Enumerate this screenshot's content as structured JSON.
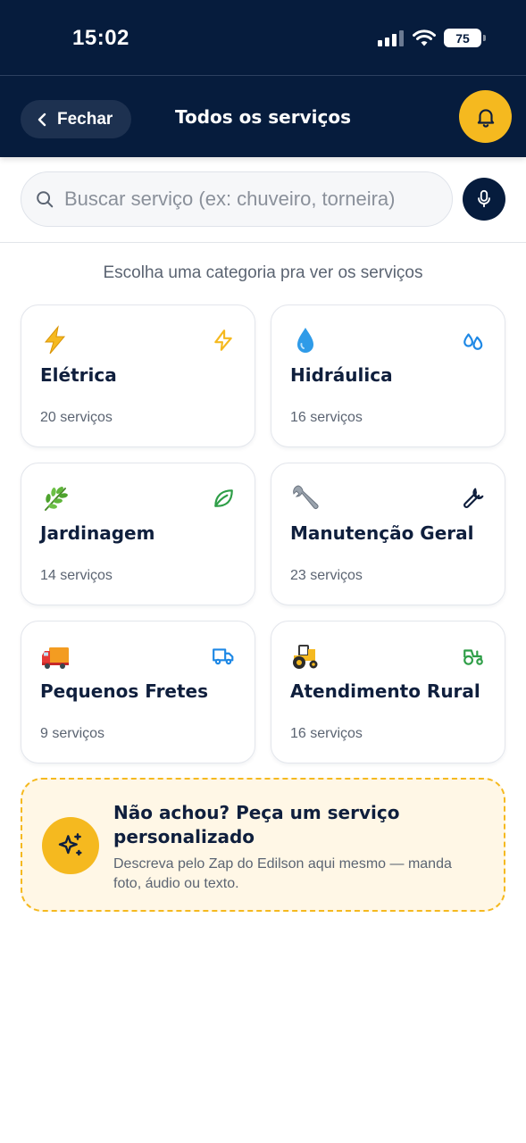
{
  "status_bar": {
    "time": "15:02",
    "battery": "75"
  },
  "header": {
    "back_label": "Fechar",
    "title": "Todos os serviços"
  },
  "search": {
    "placeholder": "Buscar serviço (ex: chuveiro, torneira)"
  },
  "hint": "Escolha uma categoria pra ver os serviços",
  "categories": [
    {
      "title": "Elétrica",
      "count": "20 serviços",
      "icon": "zap-icon",
      "accent": "#f5b91f"
    },
    {
      "title": "Hidráulica",
      "count": "16 serviços",
      "icon": "droplets-icon",
      "accent": "#1e88e5"
    },
    {
      "title": "Jardinagem",
      "count": "14 serviços",
      "icon": "leaf-icon",
      "accent": "#2e9e47"
    },
    {
      "title": "Manutenção Geral",
      "count": "23 serviços",
      "icon": "wrench-icon",
      "accent": "#0f1f3d"
    },
    {
      "title": "Pequenos Fretes",
      "count": "9 serviços",
      "icon": "truck-icon",
      "accent": "#1e88e5"
    },
    {
      "title": "Atendimento Rural",
      "count": "16 serviços",
      "icon": "tractor-icon",
      "accent": "#2e9e47"
    }
  ],
  "custom_request": {
    "title": "Não achou? Peça um serviço personalizado",
    "description": "Descreva pelo Zap do Edilson aqui mesmo — manda foto, áudio ou texto."
  },
  "colors": {
    "navy": "#061c3d",
    "yellow": "#f5b91f",
    "cream": "#fff7e6"
  }
}
